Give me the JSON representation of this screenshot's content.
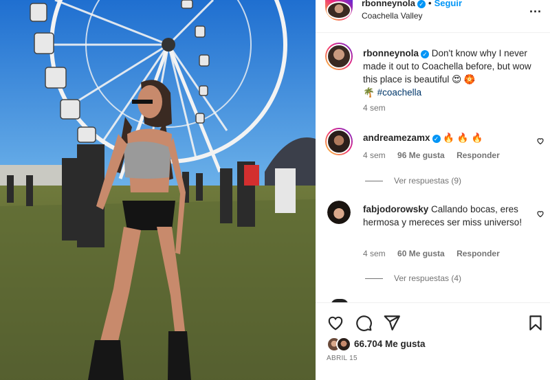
{
  "header": {
    "username": "rbonneynola",
    "verified": true,
    "follow_label": "Seguir",
    "location": "Coachella Valley",
    "more_label": "..."
  },
  "caption": {
    "username": "rbonneynola",
    "text": "Don't know why I never made it out to Coachella before, but wow this place is beautiful 😍 🏵️",
    "hashtag_prefix": "🌴",
    "hashtag": "#coachella",
    "time": "4 sem"
  },
  "comments": [
    {
      "username": "andreamezamx",
      "verified": true,
      "text": "🔥 🔥 🔥",
      "time": "4 sem",
      "likes": "96 Me gusta",
      "reply": "Responder",
      "view_replies": "Ver respuestas (9)"
    },
    {
      "username": "fabjodorowsky",
      "verified": false,
      "text": "Callando bocas, eres hermosa y mereces ser miss universo!",
      "time": "4 sem",
      "likes": "60 Me gusta",
      "reply": "Responder",
      "view_replies": "Ver respuestas (4)"
    }
  ],
  "footer": {
    "likes_count": "66.704 Me gusta",
    "date": "ABRIL 15"
  },
  "icons": {
    "like": "heart-icon",
    "comment": "comment-icon",
    "share": "send-icon",
    "save": "bookmark-icon",
    "more": "more-icon"
  },
  "colors": {
    "accent": "#0095f6",
    "text": "#262626",
    "muted": "#737373",
    "hashtag": "#00376b"
  }
}
